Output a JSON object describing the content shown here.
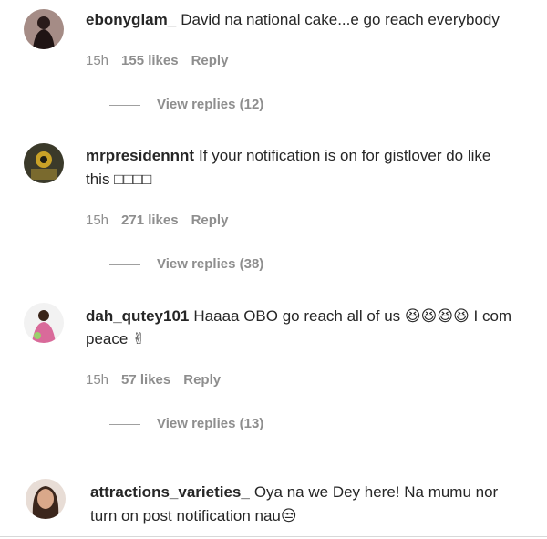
{
  "comments": [
    {
      "username": "ebonyglam_",
      "text": "David na national cake...e go reach everybody",
      "text_line2": "",
      "time": "15h",
      "likes": "155 likes",
      "reply": "Reply",
      "view_replies": "View replies (12)"
    },
    {
      "username": "mrpresidennnt",
      "text": "If your notification is on for gistlover do like",
      "text_line2": "this □□□□",
      "time": "15h",
      "likes": "271 likes",
      "reply": "Reply",
      "view_replies": "View replies (38)"
    },
    {
      "username": "dah_qutey101",
      "text": "Haaaa OBO go reach all of us 😆😆😆😆 I com",
      "text_line2": "peace ✌",
      "time": "15h",
      "likes": "57 likes",
      "reply": "Reply",
      "view_replies": "View replies (13)"
    },
    {
      "username": "attractions_varieties_",
      "text": "Oya na we Dey here! Na mumu nor",
      "text_line2": "turn on post notification nau😒",
      "time": "",
      "likes": "",
      "reply": "",
      "view_replies": ""
    }
  ],
  "colors": {
    "text": "#262626",
    "secondary": "#8e8e8e"
  }
}
